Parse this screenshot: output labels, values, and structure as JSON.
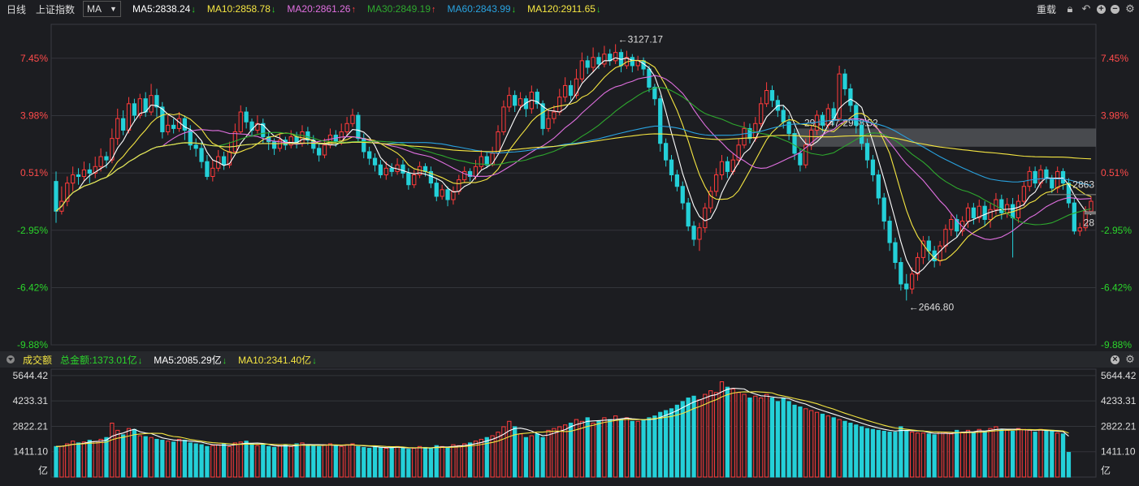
{
  "header": {
    "period": "日线",
    "index_name": "上证指数",
    "indicator": "MA",
    "ma": [
      {
        "label": "MA5:2838.24",
        "color": "#ffffff",
        "dir": "down"
      },
      {
        "label": "MA10:2858.78",
        "color": "#f5e642",
        "dir": "down"
      },
      {
        "label": "MA20:2861.26",
        "color": "#e070e0",
        "dir": "up"
      },
      {
        "label": "MA30:2849.19",
        "color": "#2ea82e",
        "dir": "up"
      },
      {
        "label": "MA60:2843.99",
        "color": "#29a3e0",
        "dir": "down"
      },
      {
        "label": "MA120:2911.65",
        "color": "#f5e642",
        "dir": "down"
      }
    ],
    "restore_label": "重载"
  },
  "volume_header": {
    "title": "成交额",
    "items": [
      {
        "label": "总金额:1373.01亿",
        "color": "#2bd62b",
        "dir": "down"
      },
      {
        "label": "MA5:2085.29亿",
        "color": "#ffffff",
        "dir": "down"
      },
      {
        "label": "MA10:2341.40亿",
        "color": "#f5e642",
        "dir": "down"
      }
    ]
  },
  "chart_data": {
    "type": "candlestick",
    "price_axis": {
      "ticks": [
        "7.45%",
        "3.98%",
        "0.51%",
        "-2.95%",
        "-6.42%",
        "-9.88%"
      ],
      "values": [
        7.45,
        3.98,
        0.51,
        -2.95,
        -6.42,
        -9.88
      ]
    },
    "volume_axis": {
      "ticks": [
        "5644.42",
        "4233.31",
        "2822.21",
        "1411.10",
        "亿"
      ],
      "values": [
        5644.42,
        4233.31,
        2822.21,
        1411.1
      ]
    },
    "annotations": {
      "high": "←3127.17",
      "low": "←2646.80",
      "range_box": "2944.47-2968.52",
      "right_price_1": "2863",
      "right_price_2": "28"
    },
    "candles": [
      [
        0.0,
        -1.8,
        0.6,
        -2.5
      ],
      [
        -1.8,
        -1.2,
        -0.3,
        -2.0
      ],
      [
        -1.2,
        -0.1,
        0.3,
        -1.5
      ],
      [
        -0.1,
        0.4,
        0.9,
        -0.6
      ],
      [
        0.4,
        0.3,
        0.8,
        -0.2
      ],
      [
        0.3,
        0.7,
        1.2,
        0.0
      ],
      [
        0.7,
        0.5,
        1.1,
        -0.1
      ],
      [
        0.5,
        0.9,
        1.5,
        0.2
      ],
      [
        0.9,
        1.5,
        2.0,
        0.6
      ],
      [
        1.5,
        1.3,
        1.8,
        0.8
      ],
      [
        1.3,
        2.6,
        3.2,
        1.1
      ],
      [
        2.6,
        3.8,
        4.4,
        2.2
      ],
      [
        3.8,
        3.1,
        4.3,
        2.8
      ],
      [
        3.1,
        4.7,
        5.1,
        2.9
      ],
      [
        4.7,
        4.0,
        5.0,
        3.6
      ],
      [
        4.0,
        5.0,
        5.3,
        3.8
      ],
      [
        5.0,
        4.2,
        5.4,
        3.9
      ],
      [
        4.2,
        5.2,
        5.9,
        4.0
      ],
      [
        5.2,
        4.5,
        5.6,
        3.9
      ],
      [
        4.5,
        3.0,
        4.8,
        2.6
      ],
      [
        3.0,
        3.4,
        4.0,
        2.8
      ],
      [
        3.4,
        3.2,
        3.8,
        2.9
      ],
      [
        3.2,
        3.8,
        4.2,
        3.0
      ],
      [
        3.8,
        3.1,
        4.0,
        2.5
      ],
      [
        3.1,
        2.2,
        3.4,
        1.9
      ],
      [
        2.2,
        2.0,
        2.6,
        1.5
      ],
      [
        2.0,
        1.2,
        2.4,
        0.8
      ],
      [
        1.2,
        0.3,
        1.6,
        0.1
      ],
      [
        0.3,
        0.8,
        1.3,
        0.0
      ],
      [
        0.8,
        1.5,
        1.9,
        0.6
      ],
      [
        1.5,
        1.0,
        1.8,
        0.7
      ],
      [
        1.0,
        1.8,
        2.4,
        0.8
      ],
      [
        1.8,
        3.0,
        3.5,
        1.7
      ],
      [
        3.0,
        4.2,
        4.6,
        2.9
      ],
      [
        4.2,
        3.6,
        4.5,
        3.2
      ],
      [
        3.6,
        3.1,
        3.8,
        2.7
      ],
      [
        3.1,
        3.5,
        4.0,
        2.9
      ],
      [
        3.5,
        2.7,
        3.8,
        2.3
      ],
      [
        2.7,
        2.4,
        3.0,
        1.9
      ],
      [
        2.4,
        2.0,
        2.6,
        1.6
      ],
      [
        2.0,
        2.5,
        2.9,
        1.8
      ],
      [
        2.5,
        2.2,
        2.7,
        1.9
      ],
      [
        2.2,
        2.7,
        3.1,
        2.0
      ],
      [
        2.7,
        2.3,
        3.0,
        2.0
      ],
      [
        2.3,
        3.0,
        3.4,
        2.1
      ],
      [
        3.0,
        2.5,
        3.3,
        2.2
      ],
      [
        2.5,
        2.0,
        2.8,
        1.7
      ],
      [
        2.0,
        1.6,
        2.3,
        1.2
      ],
      [
        1.6,
        2.2,
        2.6,
        1.4
      ],
      [
        2.2,
        2.8,
        3.2,
        2.0
      ],
      [
        2.8,
        2.4,
        3.1,
        2.1
      ],
      [
        2.4,
        3.0,
        3.5,
        2.2
      ],
      [
        3.0,
        3.5,
        3.9,
        2.8
      ],
      [
        3.5,
        4.0,
        4.4,
        3.3
      ],
      [
        4.0,
        2.6,
        4.2,
        2.4
      ],
      [
        2.6,
        1.8,
        2.9,
        1.4
      ],
      [
        1.8,
        1.4,
        2.1,
        1.0
      ],
      [
        1.4,
        1.0,
        1.7,
        0.6
      ],
      [
        1.0,
        0.4,
        1.3,
        0.2
      ],
      [
        0.4,
        0.8,
        1.2,
        0.1
      ],
      [
        0.8,
        0.6,
        1.1,
        0.3
      ],
      [
        0.6,
        1.0,
        1.4,
        0.4
      ],
      [
        1.0,
        0.5,
        1.3,
        0.2
      ],
      [
        0.5,
        -0.2,
        0.8,
        -0.5
      ],
      [
        -0.2,
        0.4,
        0.7,
        -0.4
      ],
      [
        0.4,
        0.9,
        1.2,
        0.2
      ],
      [
        0.9,
        0.6,
        1.1,
        0.3
      ],
      [
        0.6,
        -0.1,
        0.9,
        -0.4
      ],
      [
        -0.1,
        -0.9,
        0.2,
        -1.2
      ],
      [
        -0.9,
        -0.5,
        -0.2,
        -1.1
      ],
      [
        -0.5,
        -1.1,
        -0.3,
        -1.5
      ],
      [
        -1.1,
        -0.6,
        -0.3,
        -1.4
      ],
      [
        -0.6,
        0.1,
        0.4,
        -0.8
      ],
      [
        0.1,
        0.6,
        0.9,
        -0.1
      ],
      [
        0.6,
        0.3,
        0.8,
        0.0
      ],
      [
        0.3,
        0.9,
        1.3,
        0.1
      ],
      [
        0.9,
        1.5,
        1.9,
        0.7
      ],
      [
        1.5,
        1.0,
        1.8,
        0.8
      ],
      [
        1.0,
        1.7,
        2.1,
        0.9
      ],
      [
        1.7,
        3.0,
        3.4,
        1.6
      ],
      [
        3.0,
        4.5,
        4.9,
        2.8
      ],
      [
        4.5,
        5.2,
        5.7,
        4.2
      ],
      [
        5.2,
        4.6,
        5.5,
        4.2
      ],
      [
        4.6,
        5.0,
        5.4,
        4.3
      ],
      [
        5.0,
        4.4,
        5.2,
        3.9
      ],
      [
        4.4,
        5.4,
        5.8,
        4.1
      ],
      [
        5.4,
        4.7,
        5.6,
        4.4
      ],
      [
        4.7,
        3.2,
        4.9,
        2.8
      ],
      [
        3.2,
        3.8,
        4.3,
        3.0
      ],
      [
        3.8,
        4.2,
        4.6,
        3.5
      ],
      [
        4.2,
        5.1,
        5.6,
        4.0
      ],
      [
        5.1,
        5.8,
        6.3,
        4.8
      ],
      [
        5.8,
        5.2,
        6.1,
        4.9
      ],
      [
        5.2,
        6.2,
        6.8,
        5.0
      ],
      [
        6.2,
        7.3,
        7.8,
        6.0
      ],
      [
        7.3,
        6.9,
        7.6,
        6.5
      ],
      [
        6.9,
        7.5,
        8.1,
        6.6
      ],
      [
        7.5,
        7.1,
        7.8,
        6.8
      ],
      [
        7.1,
        7.7,
        8.2,
        6.9
      ],
      [
        7.7,
        7.3,
        8.0,
        7.0
      ],
      [
        7.3,
        7.8,
        8.3,
        7.1
      ],
      [
        7.8,
        7.0,
        8.0,
        6.6
      ],
      [
        7.0,
        7.5,
        7.9,
        6.8
      ],
      [
        7.5,
        7.0,
        7.7,
        6.6
      ],
      [
        7.0,
        7.3,
        7.6,
        6.7
      ],
      [
        7.3,
        6.8,
        7.5,
        6.4
      ],
      [
        6.8,
        5.7,
        7.0,
        5.4
      ],
      [
        5.7,
        5.0,
        5.9,
        4.6
      ],
      [
        5.0,
        2.3,
        5.2,
        1.8
      ],
      [
        2.3,
        1.3,
        2.6,
        0.9
      ],
      [
        1.3,
        0.4,
        1.6,
        0.0
      ],
      [
        0.4,
        -0.3,
        0.7,
        -0.6
      ],
      [
        -0.3,
        -1.3,
        0.0,
        -1.7
      ],
      [
        -1.3,
        -2.7,
        -1.0,
        -3.0
      ],
      [
        -2.7,
        -3.5,
        -2.4,
        -3.9
      ],
      [
        -3.5,
        -2.8,
        -2.5,
        -4.2
      ],
      [
        -2.8,
        -1.6,
        -1.3,
        -3.1
      ],
      [
        -1.6,
        -0.6,
        -0.3,
        -1.9
      ],
      [
        -0.6,
        0.4,
        0.8,
        -0.9
      ],
      [
        0.4,
        1.2,
        1.6,
        0.1
      ],
      [
        1.2,
        0.6,
        1.5,
        0.2
      ],
      [
        0.6,
        1.3,
        1.7,
        0.4
      ],
      [
        1.3,
        2.2,
        2.6,
        1.0
      ],
      [
        2.2,
        3.2,
        3.6,
        2.0
      ],
      [
        3.2,
        2.6,
        3.5,
        2.3
      ],
      [
        2.6,
        3.5,
        3.9,
        2.4
      ],
      [
        3.5,
        4.7,
        5.1,
        3.3
      ],
      [
        4.7,
        5.5,
        6.0,
        4.5
      ],
      [
        5.5,
        4.9,
        5.8,
        4.5
      ],
      [
        4.9,
        4.3,
        5.2,
        3.9
      ],
      [
        4.3,
        3.6,
        4.6,
        3.2
      ],
      [
        3.6,
        2.9,
        4.0,
        2.5
      ],
      [
        2.9,
        1.7,
        3.2,
        1.3
      ],
      [
        1.7,
        1.0,
        2.0,
        0.6
      ],
      [
        1.0,
        2.2,
        2.6,
        0.8
      ],
      [
        2.2,
        3.1,
        3.4,
        1.9
      ],
      [
        3.1,
        4.0,
        4.3,
        2.8
      ],
      [
        4.0,
        3.4,
        4.2,
        3.0
      ],
      [
        3.4,
        4.4,
        4.7,
        3.2
      ],
      [
        4.4,
        3.8,
        4.8,
        3.4
      ],
      [
        3.8,
        6.5,
        7.0,
        3.6
      ],
      [
        6.5,
        5.6,
        6.8,
        5.2
      ],
      [
        5.6,
        4.6,
        5.9,
        4.2
      ],
      [
        4.6,
        3.4,
        4.8,
        2.9
      ],
      [
        3.4,
        2.3,
        3.6,
        1.9
      ],
      [
        2.3,
        1.3,
        2.6,
        0.8
      ],
      [
        1.3,
        0.4,
        1.6,
        0.0
      ],
      [
        0.4,
        -1.0,
        0.7,
        -1.4
      ],
      [
        -1.0,
        -2.4,
        -0.7,
        -2.9
      ],
      [
        -2.4,
        -3.7,
        -2.1,
        -4.2
      ],
      [
        -3.7,
        -4.9,
        -3.4,
        -5.3
      ],
      [
        -4.9,
        -6.2,
        -4.6,
        -6.6
      ],
      [
        -6.2,
        -6.5,
        -5.6,
        -7.2
      ],
      [
        -6.5,
        -5.6,
        -5.2,
        -6.8
      ],
      [
        -5.6,
        -4.6,
        -4.3,
        -6.0
      ],
      [
        -4.6,
        -3.6,
        -3.3,
        -5.0
      ],
      [
        -3.6,
        -4.2,
        -3.3,
        -4.8
      ],
      [
        -4.2,
        -4.8,
        -3.9,
        -5.2
      ],
      [
        -4.8,
        -3.9,
        -3.6,
        -5.1
      ],
      [
        -3.9,
        -2.9,
        -2.6,
        -4.3
      ],
      [
        -2.9,
        -2.3,
        -2.0,
        -3.3
      ],
      [
        -2.3,
        -3.0,
        -2.0,
        -3.4
      ],
      [
        -3.0,
        -2.4,
        -2.1,
        -3.3
      ],
      [
        -2.4,
        -1.6,
        -1.3,
        -2.8
      ],
      [
        -1.6,
        -2.2,
        -1.3,
        -2.6
      ],
      [
        -2.2,
        -1.5,
        -1.1,
        -2.5
      ],
      [
        -1.5,
        -2.3,
        -1.2,
        -2.7
      ],
      [
        -2.3,
        -1.7,
        -1.3,
        -2.8
      ],
      [
        -1.7,
        -1.1,
        -0.7,
        -2.0
      ],
      [
        -1.1,
        -1.9,
        -0.8,
        -2.3
      ],
      [
        -1.9,
        -1.4,
        -1.0,
        -2.2
      ],
      [
        -1.4,
        -2.2,
        -1.0,
        -4.6
      ],
      [
        -2.2,
        -1.2,
        -0.8,
        -2.5
      ],
      [
        -1.2,
        -0.3,
        0.0,
        -1.5
      ],
      [
        -0.3,
        0.6,
        0.9,
        -0.6
      ],
      [
        0.6,
        -0.1,
        0.9,
        -0.4
      ],
      [
        -0.1,
        0.7,
        1.0,
        -0.4
      ],
      [
        0.7,
        0.2,
        0.9,
        -0.1
      ],
      [
        0.2,
        -0.4,
        0.4,
        -0.7
      ],
      [
        -0.4,
        0.6,
        0.9,
        -0.7
      ],
      [
        0.6,
        -0.1,
        0.8,
        -0.5
      ],
      [
        -0.1,
        -1.3,
        0.2,
        -1.6
      ],
      [
        -1.3,
        -3.0,
        -1.0,
        -3.2
      ],
      [
        -3.0,
        -2.8,
        -2.5,
        -3.3
      ],
      [
        -2.8,
        -1.8,
        -1.5,
        -3.0
      ],
      [
        -1.8,
        -1.2,
        -0.9,
        -2.0
      ]
    ],
    "volumes": [
      1700,
      1720,
      1850,
      2000,
      1900,
      1950,
      2050,
      1980,
      2100,
      2200,
      3000,
      2600,
      2350,
      2700,
      2650,
      2300,
      2250,
      2200,
      2100,
      2050,
      2000,
      1950,
      2100,
      2050,
      1900,
      1850,
      1800,
      1700,
      1750,
      1800,
      1850,
      1700,
      1900,
      1950,
      2000,
      1850,
      1750,
      1800,
      1700,
      1650,
      1750,
      1800,
      1700,
      1850,
      1900,
      1800,
      1750,
      1700,
      1800,
      1850,
      1750,
      1700,
      1800,
      1850,
      1700,
      1650,
      1600,
      1700,
      1650,
      1600,
      1650,
      1700,
      1600,
      1550,
      1600,
      1700,
      1650,
      1600,
      1750,
      1700,
      1650,
      1800,
      1750,
      1850,
      1900,
      2000,
      2100,
      2200,
      2300,
      2500,
      2800,
      3100,
      2800,
      2400,
      2200,
      2300,
      2400,
      2200,
      2600,
      2700,
      2800,
      2900,
      3000,
      3200,
      3100,
      3300,
      3000,
      3100,
      3300,
      3200,
      3400,
      3200,
      3300,
      3100,
      3100,
      3200,
      3300,
      3400,
      3600,
      3700,
      3800,
      4000,
      4200,
      4400,
      4500,
      4300,
      4600,
      4800,
      4700,
      5300,
      5000,
      4900,
      4700,
      4600,
      4400,
      4500,
      4400,
      4600,
      4400,
      4200,
      4400,
      4200,
      4000,
      3900,
      3800,
      3700,
      3600,
      3500,
      3400,
      3300,
      3200,
      3100,
      3000,
      2900,
      2800,
      2700,
      2650,
      2600,
      2550,
      2500,
      2500,
      2800,
      2600,
      2500,
      2450,
      2450,
      2400,
      2350,
      2500,
      2450,
      2400,
      2600,
      2500,
      2600,
      2500,
      2650,
      2550,
      2700,
      2800,
      2650,
      2600,
      2550,
      2700,
      2650,
      2600,
      2500,
      2650,
      2550,
      2600,
      2450,
      2400,
      1373
    ],
    "ma_color_list": [
      "#ffffff",
      "#f5e642",
      "#e070e0",
      "#2ea82e",
      "#29a3e0",
      "#f5e642"
    ]
  }
}
